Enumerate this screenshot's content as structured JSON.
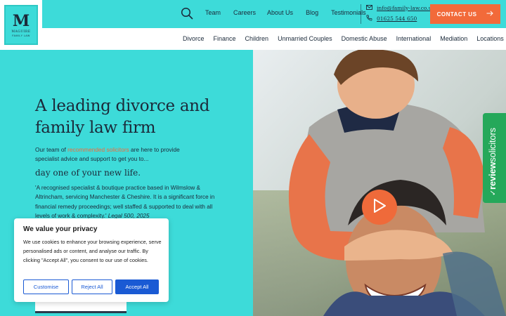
{
  "logo": {
    "monogram": "M",
    "name": "MAGUIRE",
    "tagline": "FAMILY LAW"
  },
  "top_nav": [
    "Team",
    "Careers",
    "About Us",
    "Blog",
    "Testimonials"
  ],
  "contact": {
    "email": "info@family-law.co.uk",
    "phone": "01625 544 650",
    "button_label": "CONTACT US"
  },
  "sub_nav": [
    "Divorce",
    "Finance",
    "Children",
    "Unmarried Couples",
    "Domestic Abuse",
    "International",
    "Mediation",
    "Locations"
  ],
  "hero": {
    "title": "A leading divorce and family law firm",
    "intro_before": "Our team of ",
    "intro_link": "recommended solicitors",
    "intro_after": " are here to provide specialist advice and support to get you to...",
    "subheading": "day one of your new life.",
    "quote": "'A recognised specialist & boutique practice based in Wilmslow & Altrincham, servicing Manchester & Cheshire. It is a significant force in financial remedy proceedings; well staffed & supported to deal with all levels of work & complexity.'",
    "quote_source": "Legal 500, 2025"
  },
  "review_tab": {
    "bold": "review",
    "rest": "solicitors"
  },
  "cookie": {
    "title": "We value your privacy",
    "text": "We use cookies to enhance your browsing experience, serve personalised ads or content, and analyse our traffic. By clicking \"Accept All\", you consent to our use of cookies.",
    "customise": "Customise",
    "reject": "Reject All",
    "accept": "Accept All"
  },
  "colors": {
    "teal": "#3ddbd9",
    "orange": "#f26a3a",
    "navy": "#1b2a3a",
    "cookie_blue": "#1a5ad4",
    "review_green": "#25a85a"
  }
}
